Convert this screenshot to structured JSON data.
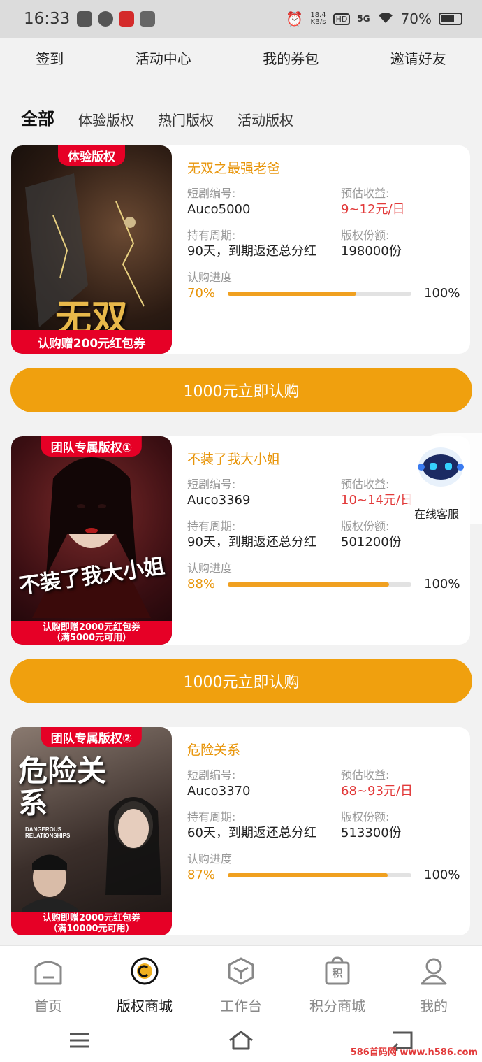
{
  "status": {
    "time": "16:33",
    "speed_top": "18.4",
    "speed_bottom": "KB/s",
    "hd": "HD",
    "network": "5G",
    "battery": "70%"
  },
  "topnav": [
    "签到",
    "活动中心",
    "我的券包",
    "邀请好友"
  ],
  "tabs": [
    "全部",
    "体验版权",
    "热门版权",
    "活动版权"
  ],
  "labels": {
    "code": "短剧编号:",
    "income": "预估收益:",
    "period": "持有周期:",
    "shares": "版权份额:",
    "progress": "认购进度"
  },
  "cards": [
    {
      "badge": "体验版权",
      "poster_title": "无双",
      "poster_footer": "认购赠200元红包券",
      "poster_footer2": "",
      "title": "无双之最强老爸",
      "code": "Auco5000",
      "income": "9~12元/日",
      "period": "90天，到期返还总分红",
      "shares": "198000份",
      "progress_pct": "70%",
      "progress_value": 0.7,
      "progress_total": "100%",
      "button": "1000元立即认购"
    },
    {
      "badge": "团队专属版权①",
      "poster_title": "不装了我大小姐",
      "poster_footer": "认购即赠2000元红包券",
      "poster_footer2": "（满5000元可用）",
      "title": "不装了我大小姐",
      "code": "Auco3369",
      "income": "10~14元/日",
      "period": "90天，到期返还总分红",
      "shares": "501200份",
      "progress_pct": "88%",
      "progress_value": 0.88,
      "progress_total": "100%",
      "button": "1000元立即认购"
    },
    {
      "badge": "团队专属版权②",
      "poster_title": "危险关系",
      "poster_subtitle": "DANGEROUS RELATIONSHIPS",
      "poster_footer": "认购即赠2000元红包券",
      "poster_footer2": "（满10000元可用）",
      "title": "危险关系",
      "code": "Auco3370",
      "income": "68~93元/日",
      "period": "60天，到期返还总分红",
      "shares": "513300份",
      "progress_pct": "87%",
      "progress_value": 0.87,
      "progress_total": "100%"
    }
  ],
  "service": {
    "label": "在线客服"
  },
  "bottomnav": [
    {
      "label": "首页",
      "icon": "home-icon"
    },
    {
      "label": "版权商城",
      "icon": "copyright-icon",
      "active": true
    },
    {
      "label": "工作台",
      "icon": "cube-icon"
    },
    {
      "label": "积分商城",
      "icon": "points-bag-icon",
      "icon_text": "积"
    },
    {
      "label": "我的",
      "icon": "user-icon"
    }
  ],
  "watermark": "586首码网 www.h586.com",
  "colors": {
    "accent": "#f0a00e",
    "title_orange": "#e8950a",
    "income_red": "#e23a3a",
    "badge_red": "#e60026"
  }
}
